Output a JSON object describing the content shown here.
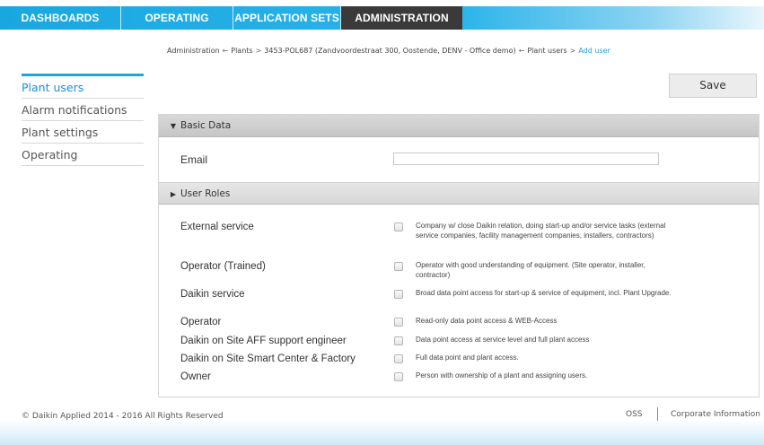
{
  "nav": {
    "tabs": [
      {
        "label": "DASHBOARDS"
      },
      {
        "label": "OPERATING"
      },
      {
        "label": "APPLICATION SETS"
      },
      {
        "label": "ADMINISTRATION",
        "active": true
      }
    ]
  },
  "breadcrumb": {
    "items": [
      "Administration",
      "Plants",
      "3453-POL687 (Zandvoordestraat 300, Oostende, DENV - Office demo)",
      "Plant users",
      "Add user"
    ],
    "separators": [
      "←",
      ">",
      "←",
      ">"
    ]
  },
  "sidebar": {
    "items": [
      {
        "label": "Plant users",
        "active": true
      },
      {
        "label": "Alarm notifications"
      },
      {
        "label": "Plant settings"
      },
      {
        "label": "Operating"
      }
    ]
  },
  "toolbar": {
    "save_label": "Save"
  },
  "basic_data": {
    "title": "Basic Data",
    "email_label": "Email",
    "email_value": ""
  },
  "user_roles": {
    "title": "User Roles",
    "roles": [
      {
        "name": "External service",
        "desc": "Company w/ close Daikin relation, doing start-up and/or service tasks (external service companies, facility management companies, installers, contractors)",
        "checked": false
      },
      {
        "name": "Operator (Trained)",
        "desc": "Operator with good understanding of equipment. (Site operator, installer, contractor)",
        "checked": false
      },
      {
        "name": "Daikin service",
        "desc": "Broad data point access for start-up & service of equipment, incl. Plant Upgrade.",
        "checked": false
      },
      {
        "name": "Operator",
        "desc": "Read-only data point access & WEB-Access",
        "checked": false
      },
      {
        "name": "Daikin on Site AFF support engineer",
        "desc": "Data point access at service level and full plant access",
        "checked": false
      },
      {
        "name": "Daikin on Site Smart Center & Factory",
        "desc": "Full data point and plant access.",
        "checked": false
      },
      {
        "name": "Owner",
        "desc": "Person with ownership of a plant and assigning users.",
        "checked": false
      }
    ]
  },
  "footer": {
    "copyright": "© Daikin Applied 2014 - 2016 All Rights Reserved",
    "links": [
      "OSS",
      "Corporate Information"
    ]
  },
  "colors": {
    "accent": "#1aa7e0",
    "active_tab": "#3a3a3a",
    "link": "#2a9fd8"
  },
  "icons": {
    "basic_caret": "caret-down-icon",
    "roles_caret": "caret-right-icon"
  }
}
